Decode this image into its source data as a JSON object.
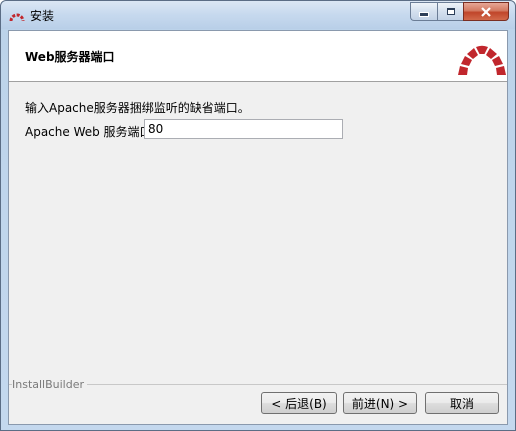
{
  "window": {
    "title": "安装",
    "controls": {
      "minimize_icon": "minimize-icon",
      "maximize_icon": "maximize-icon",
      "close_icon": "close-icon"
    }
  },
  "header": {
    "title": "Web服务器端口",
    "logo_icon": "bitnami-arc-logo",
    "logo_color": "#c1272d"
  },
  "content": {
    "description": "输入Apache服务器捆绑监听的缺省端口。",
    "port_field": {
      "label": "Apache Web 服务端口",
      "value": "80"
    }
  },
  "footer": {
    "brand": "InstallBuilder",
    "back_label": "< 后退(B)",
    "next_label": "前进(N) >",
    "cancel_label": "取消"
  }
}
